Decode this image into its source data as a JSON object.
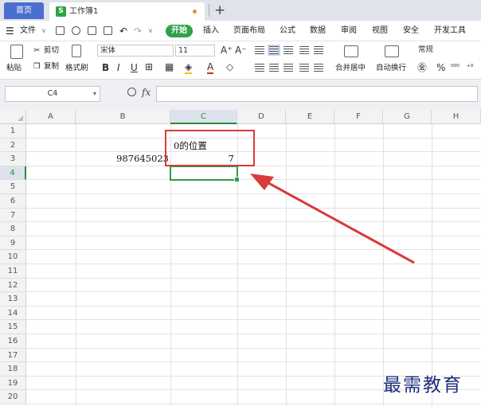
{
  "tabs": {
    "home": "首页",
    "document": "工作簿1",
    "new_tab": "+"
  },
  "menu": {
    "file": "文件",
    "items": [
      "开始",
      "插入",
      "页面布局",
      "公式",
      "数据",
      "审阅",
      "视图",
      "安全",
      "开发工具"
    ]
  },
  "ribbon": {
    "paste": "粘贴",
    "cut": "剪切",
    "copy": "复制",
    "format_painter": "格式刷",
    "font_name": "宋体",
    "font_size": "11",
    "bold": "B",
    "italic": "I",
    "underline": "U",
    "merge_center": "合并居中",
    "wrap_text": "自动换行",
    "number_format": "常规",
    "percent": "%"
  },
  "formula_bar": {
    "name_box": "C4",
    "fx": "fx",
    "formula": ""
  },
  "sheet": {
    "columns": [
      "A",
      "B",
      "C",
      "D",
      "E",
      "F",
      "G",
      "H"
    ],
    "rows": [
      "1",
      "2",
      "3",
      "4",
      "5",
      "6",
      "7",
      "8",
      "9",
      "10",
      "11",
      "12",
      "13",
      "14",
      "15",
      "16",
      "17",
      "18",
      "19",
      "20"
    ],
    "active_cell": "C4",
    "cells": {
      "C2": "0的位置",
      "B3": "987645023",
      "C3": "7"
    }
  },
  "colors": {
    "accent_green": "#2da248",
    "annotation_red": "#d93a3a",
    "home_tab": "#4a6fd0"
  },
  "watermark": "最需教育"
}
